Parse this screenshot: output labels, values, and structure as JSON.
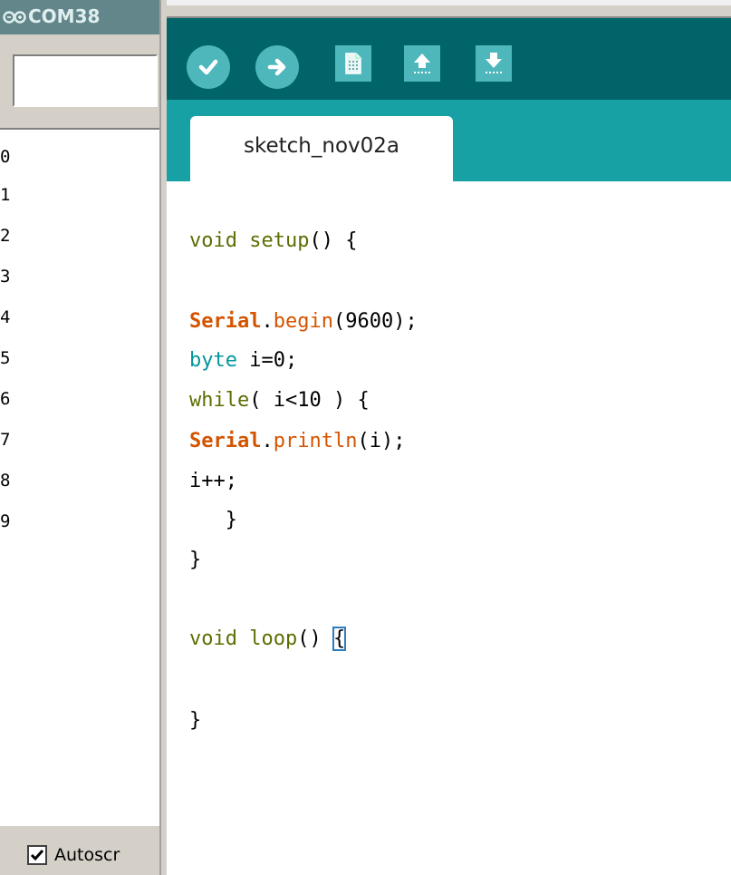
{
  "serial": {
    "port": "COM38",
    "input_value": "",
    "output_lines": [
      "0",
      "1",
      "2",
      "3",
      "4",
      "5",
      "6",
      "7",
      "8",
      "9"
    ],
    "autoscroll_label": "Autoscr",
    "autoscroll_checked": true
  },
  "toolbar": {
    "buttons": [
      {
        "name": "verify",
        "icon": "check-icon"
      },
      {
        "name": "upload",
        "icon": "arrow-right-icon"
      },
      {
        "name": "new",
        "icon": "document-icon"
      },
      {
        "name": "open",
        "icon": "arrow-up-icon"
      },
      {
        "name": "save",
        "icon": "arrow-down-icon"
      }
    ]
  },
  "tabs": [
    {
      "label": "sketch_nov02a"
    }
  ],
  "editor": {
    "lines": [
      "void setup() {",
      "",
      "Serial.begin(9600);",
      "byte i=0;",
      "while( i<10 ) {",
      "Serial.println(i);",
      "i++;",
      "   }",
      "}",
      "",
      "void loop() {",
      "",
      "}"
    ]
  },
  "colors": {
    "toolbar_bg": "#006468",
    "tab_bar_bg": "#17a1a5",
    "button_bg": "#4db7bb",
    "keyword": "#5e6d03",
    "type": "#00979c",
    "function": "#d35400"
  }
}
